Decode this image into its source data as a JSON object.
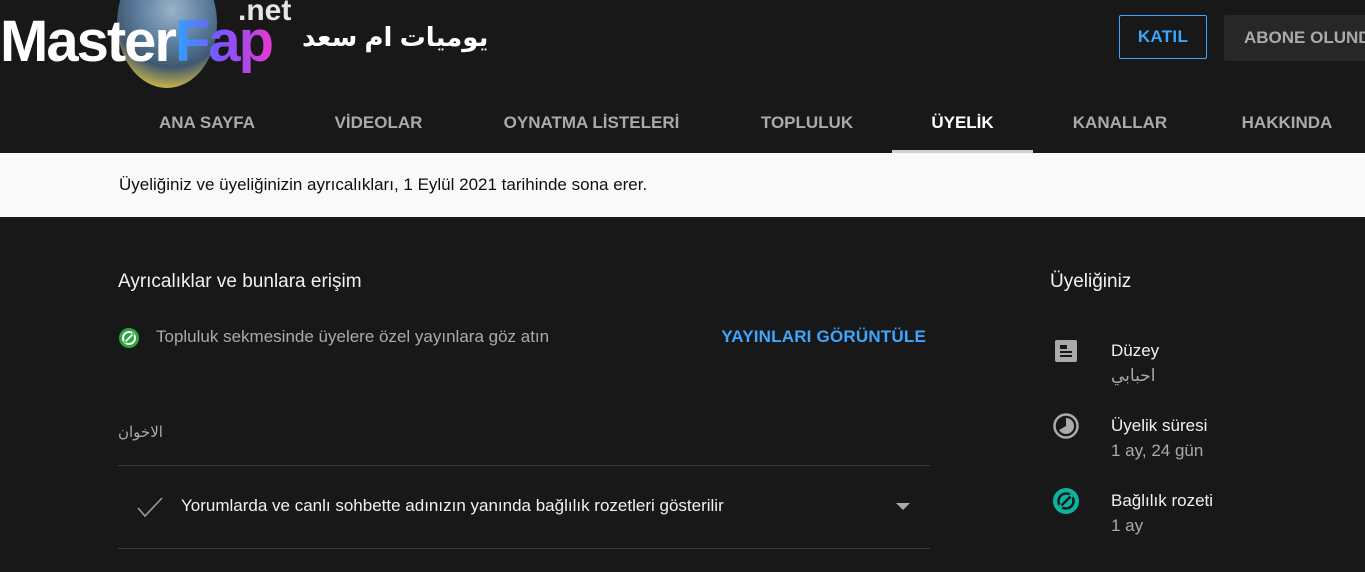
{
  "header": {
    "channel_name": "يوميات ام سعد",
    "join_label": "KATIL",
    "subscribed_label": "ABONE OLUNDU",
    "watermark": {
      "brand_part1": "Master",
      "brand_part2": "Fap",
      "brand_suffix": ".net"
    }
  },
  "tabs": [
    {
      "label": "ANA SAYFA"
    },
    {
      "label": "VİDEOLAR"
    },
    {
      "label": "OYNATMA LİSTELERİ"
    },
    {
      "label": "TOPLULUK"
    },
    {
      "label": "ÜYELİK"
    },
    {
      "label": "KANALLAR"
    },
    {
      "label": "HAKKINDA"
    }
  ],
  "banner": {
    "text": "Üyeliğiniz ve üyeliğinizin ayrıcalıkları, 1 Eylül 2021 tarihinde sona erer."
  },
  "perks": {
    "title": "Ayrıcalıklar ve bunlara erişim",
    "community_perk": "Topluluk sekmesinde üyelere özel yayınlara göz atın",
    "view_posts_label": "YAYINLARI GÖRÜNTÜLE",
    "level_name": "الاخوان",
    "badge_perk": "Yorumlarda ve canlı sohbette adınızın yanında bağlılık rozetleri gösterilir"
  },
  "membership": {
    "title": "Üyeliğiniz",
    "items": [
      {
        "label": "Düzey",
        "value": "احبابي",
        "icon": "badge-card-icon"
      },
      {
        "label": "Üyelik süresi",
        "value": "1 ay, 24 gün",
        "icon": "clock-pie-icon"
      },
      {
        "label": "Bağlılık rozeti",
        "value": "1 ay",
        "icon": "loyalty-badge-icon"
      }
    ]
  },
  "colors": {
    "background": "#181818",
    "accent_blue": "#3ea6ff",
    "badge_green": "#2ba640",
    "loyalty_teal": "#0bb4a0"
  }
}
